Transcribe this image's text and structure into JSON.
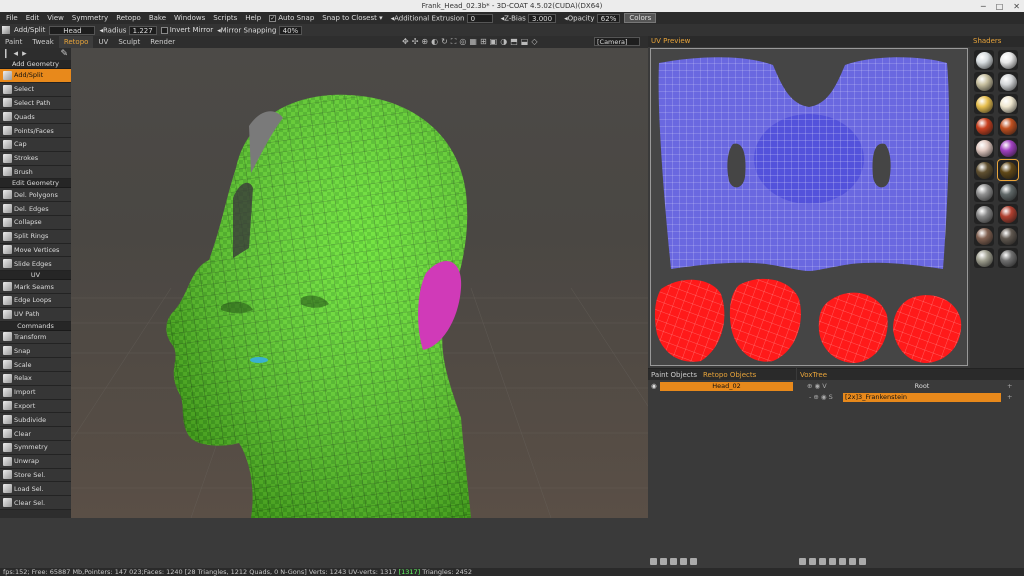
{
  "window": {
    "title": "Frank_Head_02.3b* - 3D-COAT 4.5.02(CUDA)(DX64)",
    "controls": [
      "─",
      "□",
      "✕"
    ]
  },
  "menu": [
    "File",
    "Edit",
    "View",
    "Symmetry",
    "Retopo",
    "Bake",
    "Windows",
    "Scripts",
    "Help"
  ],
  "menubar_opts": {
    "auto_snap": "Auto Snap",
    "snap_to_closest": "Snap to Closest",
    "additional_extrusion": "Additional Extrusion",
    "extrusion_value": "0",
    "zbias_label": "Z-Bias",
    "zbias_value": "3.000",
    "opacity_label": "Opacity",
    "opacity_value": "62%",
    "colors": "Colors"
  },
  "optbar": {
    "tool": "Add/Split",
    "object": "Head",
    "radius_label": "Radius",
    "radius_value": "1.227",
    "invert_mirror": "Invert Mirror",
    "mirror_snapping": "Mirror Snapping",
    "mirror_value": "40%"
  },
  "tabs": [
    "Paint",
    "Tweak",
    "Retopo",
    "UV",
    "Sculpt",
    "Render"
  ],
  "active_tab": "Retopo",
  "camera": "[Camera]",
  "tool_sections": [
    {
      "title": "Add Geometry",
      "items": [
        "Add/Split",
        "Select",
        "Select Path",
        "Quads",
        "Points/Faces",
        "Cap",
        "Strokes",
        "Brush"
      ]
    },
    {
      "title": "Edit Geometry",
      "items": [
        "Del. Polygons",
        "Del. Edges",
        "Collapse",
        "Split Rings",
        "Move Vertices",
        "Slide Edges"
      ]
    },
    {
      "title": "UV",
      "items": [
        "Mark Seams",
        "Edge Loops",
        "UV Path"
      ]
    },
    {
      "title": "Commands",
      "items": [
        "Transform",
        "Snap",
        "Scale",
        "Relax",
        "Import",
        "Export",
        "Subdivide",
        "Clear",
        "Symmetry",
        "Unwrap",
        "Store Sel.",
        "Load Sel.",
        "Clear Sel."
      ]
    }
  ],
  "selected_tool": "Add/Split",
  "uv_panel": {
    "title": "UV Preview"
  },
  "shaders": {
    "title": "Shaders",
    "swatches": [
      "#d8dde0",
      "#e8e8e8",
      "#c8c0a0",
      "#d4d6d8",
      "#e8c050",
      "#f0e8d0",
      "#c84020",
      "#c05020",
      "#e0c8c0",
      "#a040c0",
      "#605030",
      "#604818",
      "#909090",
      "#606868",
      "#888888",
      "#b04030",
      "#806050",
      "#605850",
      "#a0a090",
      "#707070"
    ]
  },
  "objects_panel": {
    "tabs": [
      "Paint Objects",
      "Retopo Objects"
    ],
    "active": "Retopo Objects",
    "items": [
      "Head_02"
    ]
  },
  "voxtree": {
    "title": "VoxTree",
    "root": "Root",
    "child": "[2x]3_Frankenstein",
    "v": "V",
    "s": "S"
  },
  "status": {
    "text": "fps:152;  Free: 65887 Mb,Pointers: 147 023;Faces: 1240 [28 Triangles, 1212 Quads, 0 N-Gons] Verts: 1243  UV-verts: 1317 ",
    "uv_highlight": "[1317]",
    "triangles": " Triangles: 2452"
  },
  "colors": {
    "accent": "#e8891b",
    "mesh": "#5ee022",
    "uv_island": "#6a68e0",
    "uv_ear": "#ff1a1a",
    "ear_patch": "#d03ab8"
  }
}
